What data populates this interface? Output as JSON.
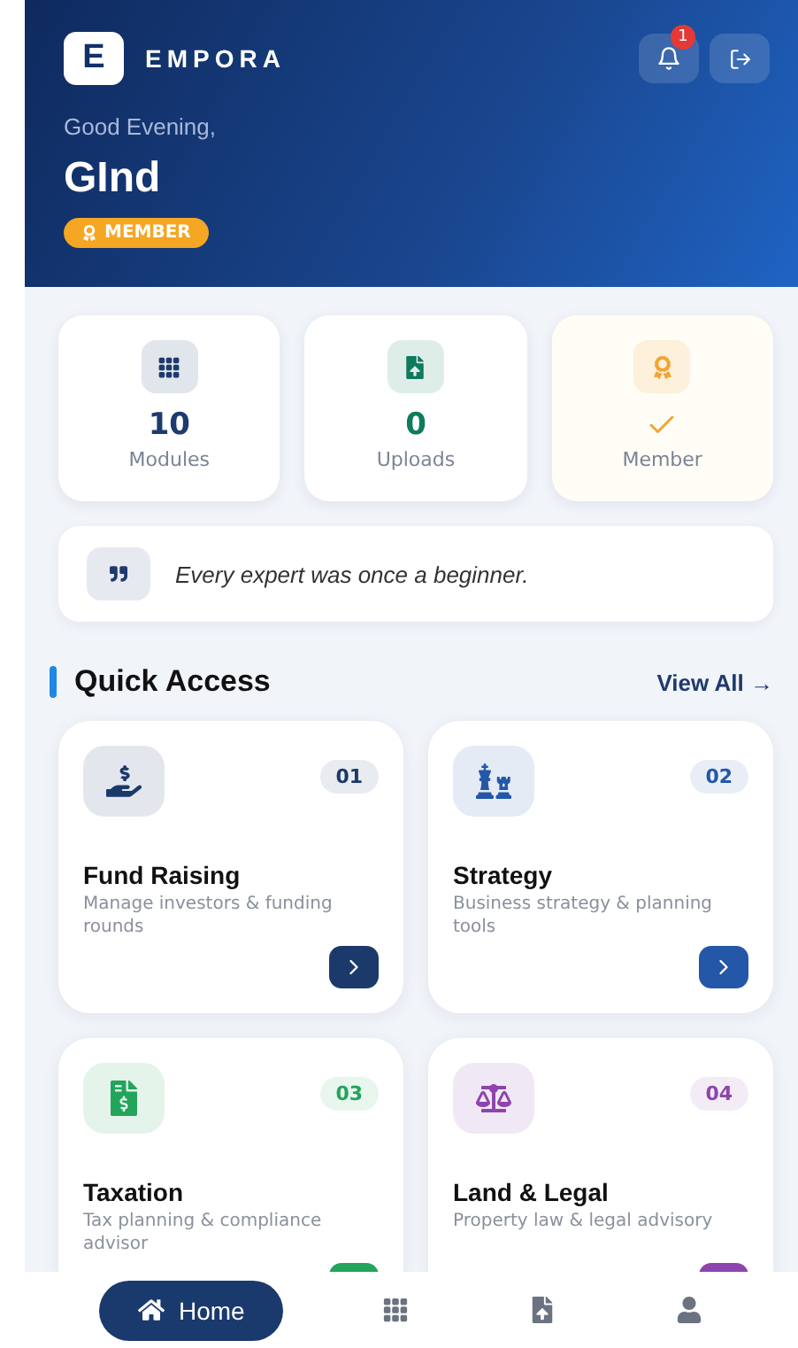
{
  "header": {
    "logo_letter": "E",
    "brand": "EMPORA",
    "notification_count": "1",
    "greeting": "Good Evening,",
    "user_name": "GInd",
    "badge": "MEMBER"
  },
  "stats": [
    {
      "kind": "grid",
      "value": "10",
      "label": "Modules",
      "color": "#1e3a6e"
    },
    {
      "kind": "upload",
      "value": "0",
      "label": "Uploads",
      "color": "#0f7a5c"
    },
    {
      "kind": "award",
      "label": "Member",
      "color": "#f2a531"
    }
  ],
  "quote": "Every expert was once a beginner.",
  "section": {
    "title": "Quick Access",
    "link": "View All →"
  },
  "modules": [
    {
      "kind": "fund",
      "number": "01",
      "title": "Fund Raising",
      "description": "Manage investors & funding rounds",
      "color": "#1b3a6b"
    },
    {
      "kind": "strategy",
      "number": "02",
      "title": "Strategy",
      "description": "Business strategy & planning tools",
      "color": "#2457a8"
    },
    {
      "kind": "tax",
      "number": "03",
      "title": "Taxation",
      "description": "Tax planning & compliance advisor",
      "color": "#23a45b"
    },
    {
      "kind": "legal",
      "number": "04",
      "title": "Land & Legal",
      "description": "Property law & legal advisory",
      "color": "#8e44ad"
    }
  ],
  "nav": [
    {
      "kind": "home",
      "label": "Home",
      "selected": true
    },
    {
      "kind": "grid",
      "selected": false
    },
    {
      "kind": "upload",
      "selected": false
    },
    {
      "kind": "user",
      "selected": false
    }
  ]
}
